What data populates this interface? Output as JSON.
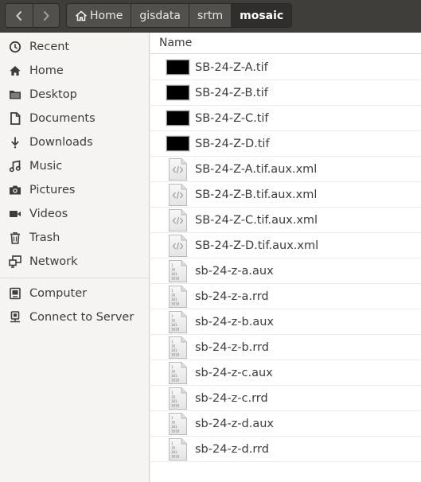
{
  "nav": {
    "back_icon": "chevron-left-icon",
    "forward_icon": "chevron-right-icon"
  },
  "breadcrumb": [
    {
      "label": "Home",
      "icon": "home-icon"
    },
    {
      "label": "gisdata"
    },
    {
      "label": "srtm"
    },
    {
      "label": "mosaic",
      "active": true
    }
  ],
  "sidebar": {
    "places": [
      {
        "label": "Recent",
        "icon": "clock-icon"
      },
      {
        "label": "Home",
        "icon": "home-icon"
      },
      {
        "label": "Desktop",
        "icon": "folder-icon"
      },
      {
        "label": "Documents",
        "icon": "document-icon"
      },
      {
        "label": "Downloads",
        "icon": "download-icon"
      },
      {
        "label": "Music",
        "icon": "music-icon"
      },
      {
        "label": "Pictures",
        "icon": "camera-icon"
      },
      {
        "label": "Videos",
        "icon": "video-icon"
      },
      {
        "label": "Trash",
        "icon": "trash-icon"
      },
      {
        "label": "Network",
        "icon": "network-icon"
      }
    ],
    "devices": [
      {
        "label": "Computer",
        "icon": "computer-icon"
      },
      {
        "label": "Connect to Server",
        "icon": "server-icon"
      }
    ]
  },
  "file_list": {
    "column_header": "Name",
    "files": [
      {
        "name": "SB-24-Z-A.tif",
        "type": "tif"
      },
      {
        "name": "SB-24-Z-B.tif",
        "type": "tif"
      },
      {
        "name": "SB-24-Z-C.tif",
        "type": "tif"
      },
      {
        "name": "SB-24-Z-D.tif",
        "type": "tif"
      },
      {
        "name": "SB-24-Z-A.tif.aux.xml",
        "type": "xml"
      },
      {
        "name": "SB-24-Z-B.tif.aux.xml",
        "type": "xml"
      },
      {
        "name": "SB-24-Z-C.tif.aux.xml",
        "type": "xml"
      },
      {
        "name": "SB-24-Z-D.tif.aux.xml",
        "type": "xml"
      },
      {
        "name": "sb-24-z-a.aux",
        "type": "binary"
      },
      {
        "name": "sb-24-z-a.rrd",
        "type": "binary"
      },
      {
        "name": "sb-24-z-b.aux",
        "type": "binary"
      },
      {
        "name": "sb-24-z-b.rrd",
        "type": "binary"
      },
      {
        "name": "sb-24-z-c.aux",
        "type": "binary"
      },
      {
        "name": "sb-24-z-c.rrd",
        "type": "binary"
      },
      {
        "name": "sb-24-z-d.aux",
        "type": "binary"
      },
      {
        "name": "sb-24-z-d.rrd",
        "type": "binary"
      }
    ]
  }
}
